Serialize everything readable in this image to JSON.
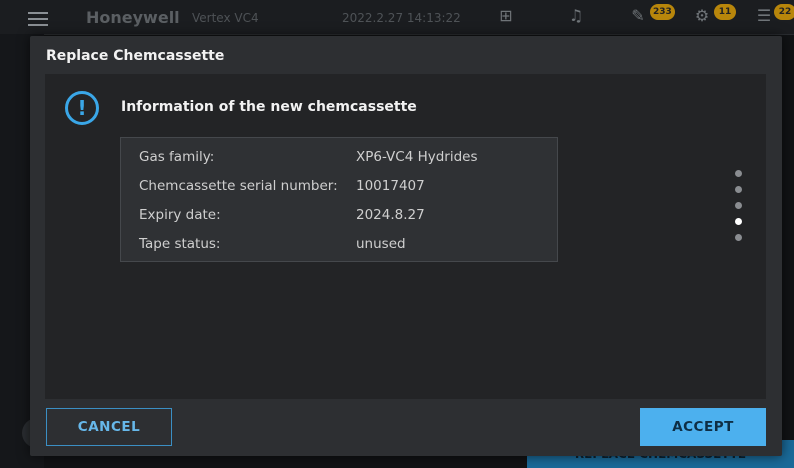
{
  "background": {
    "brand": "Honeywell",
    "model": "Vertex VC4",
    "datetime": "2022.2.27 14:13:22",
    "badges": [
      "233",
      "11",
      "22"
    ],
    "bottom_button": "REPLACE CHEMCASSETTE"
  },
  "dialog": {
    "title": "Replace Chemcassette",
    "heading": "Information of the new chemcassette",
    "rows": [
      {
        "label": "Gas family:",
        "value": "XP6-VC4 Hydrides"
      },
      {
        "label": "Chemcassette serial number:",
        "value": "10017407"
      },
      {
        "label": "Expiry date:",
        "value": "2024.8.27"
      },
      {
        "label": "Tape status:",
        "value": "unused"
      }
    ],
    "pager": {
      "total": 5,
      "current": 4
    },
    "cancel_label": "CANCEL",
    "accept_label": "ACCEPT"
  },
  "colors": {
    "accent": "#4cb0ee",
    "info_icon": "#3aa7e8"
  }
}
